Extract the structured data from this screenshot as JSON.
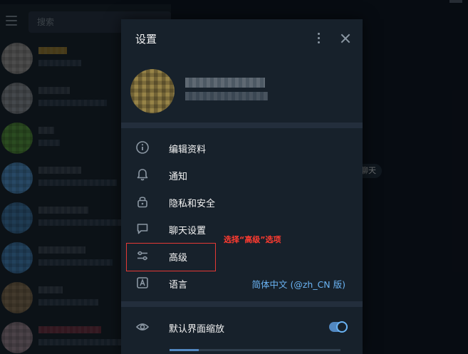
{
  "search": {
    "placeholder": "搜索"
  },
  "chat_date_pill": "聊天",
  "dialog": {
    "title": "设置",
    "menu": [
      {
        "label": "编辑资料",
        "icon": "info-icon"
      },
      {
        "label": "通知",
        "icon": "bell-icon"
      },
      {
        "label": "隐私和安全",
        "icon": "lock-icon"
      },
      {
        "label": "聊天设置",
        "icon": "chat-bubble-icon"
      },
      {
        "label": "高级",
        "icon": "sliders-icon"
      },
      {
        "label": "语言",
        "icon": "language-icon",
        "value": "简体中文 (@zh_CN 版)"
      }
    ],
    "scale": {
      "label": "默认界面缩放",
      "icon": "eye-icon",
      "enabled": true,
      "level": 0.17
    }
  },
  "annotation": {
    "text": "选择“高级”选项",
    "color": "#e53935"
  },
  "colors": {
    "accent": "#5288c1",
    "link": "#6ab3f3",
    "panel": "#17212b",
    "background": "#0e1621"
  }
}
